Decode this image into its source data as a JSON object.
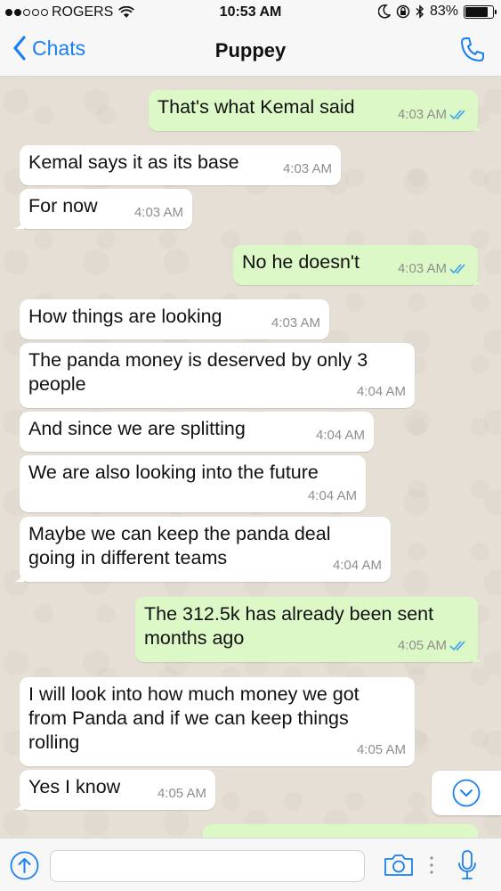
{
  "status_bar": {
    "carrier": "ROGERS",
    "time": "10:53 AM",
    "battery": "83%",
    "battery_level": 0.83,
    "signal_bars": 2
  },
  "nav": {
    "back_label": "Chats",
    "title": "Puppey"
  },
  "colors": {
    "accent": "#1a7ff2",
    "outgoing_bubble": "#dcf8c6",
    "incoming_bubble": "#ffffff",
    "read_ticks": "#4fa9e8"
  },
  "messages": [
    {
      "direction": "out",
      "text": "That's what Kemal said",
      "time": "4:03 AM",
      "read": true
    },
    {
      "direction": "in",
      "text": "Kemal says it as its base",
      "time": "4:03 AM"
    },
    {
      "direction": "in",
      "text": "For now",
      "time": "4:03 AM"
    },
    {
      "direction": "out",
      "text": "No he doesn't",
      "time": "4:03 AM",
      "read": true
    },
    {
      "direction": "in",
      "text": "How things are looking",
      "time": "4:03 AM"
    },
    {
      "direction": "in",
      "text": "The panda money is deserved by only 3\npeople",
      "time": "4:04 AM"
    },
    {
      "direction": "in",
      "text": "And since we are splitting",
      "time": "4:04 AM"
    },
    {
      "direction": "in",
      "text": "We are also looking into the future",
      "time": "4:04 AM"
    },
    {
      "direction": "in",
      "text": "Maybe we can keep the panda deal\ngoing in different teams",
      "time": "4:04 AM"
    },
    {
      "direction": "out",
      "text": "The 312.5k has already been sent\nmonths ago",
      "time": "4:05 AM",
      "read": true
    },
    {
      "direction": "in",
      "text": "I will look into how much money we got\nfrom Panda and if we can keep things\nrolling",
      "time": "4:05 AM"
    },
    {
      "direction": "in",
      "text": "Yes I know",
      "time": "4:05 AM"
    }
  ],
  "composer": {
    "value": "",
    "placeholder": ""
  },
  "icons": {
    "back": "chevron-left-icon",
    "call": "phone-icon",
    "scroll_down": "chevron-down-icon",
    "upload": "arrow-up-icon",
    "camera": "camera-icon",
    "mic": "microphone-icon"
  }
}
